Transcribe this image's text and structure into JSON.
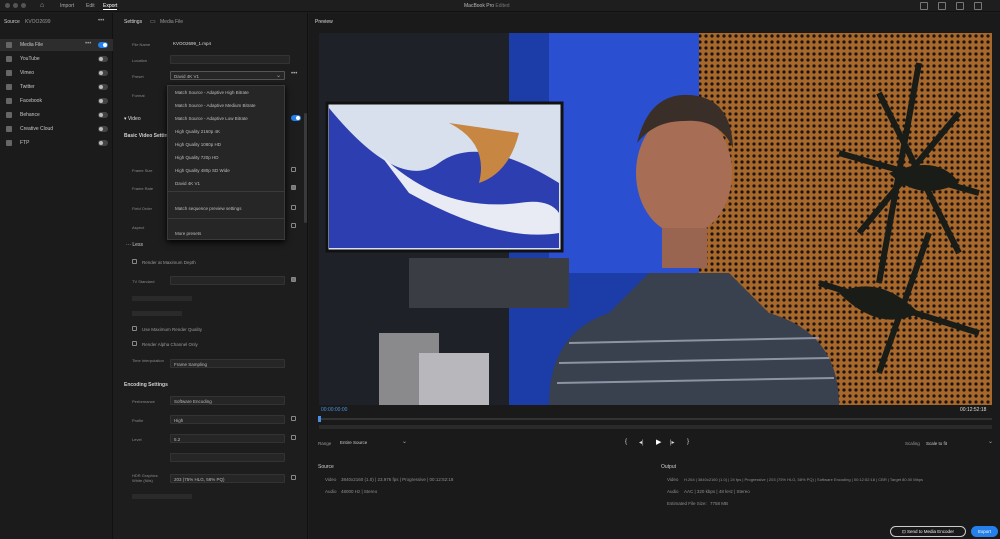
{
  "topbar": {
    "tabs": [
      "Import",
      "Edit",
      "Export"
    ],
    "window_title": "MacBook Pro",
    "document_name": "Edited"
  },
  "source": {
    "label": "Source",
    "file": "KVOO2699"
  },
  "destinations": [
    {
      "label": "Media File",
      "on": true
    },
    {
      "label": "YouTube",
      "on": false
    },
    {
      "label": "Vimeo",
      "on": false
    },
    {
      "label": "Twitter",
      "on": false
    },
    {
      "label": "Facebook",
      "on": false
    },
    {
      "label": "Behance",
      "on": false
    },
    {
      "label": "Creative Cloud",
      "on": false
    },
    {
      "label": "FTP",
      "on": false
    }
  ],
  "settings": {
    "title": "Settings",
    "subtitle": "Media File",
    "file_name_label": "File Name",
    "file_name": "KVOO2699_1.mp4",
    "location_label": "Location",
    "location": "",
    "preset_label": "Preset",
    "preset": "David 4K V1",
    "format_label": "Format",
    "video_label": "Video",
    "basic_label": "Basic Video Settings",
    "frame_size_label": "Frame Size",
    "frame_rate_label": "Frame Rate",
    "field_order_label": "Field Order",
    "aspect_label": "Aspect",
    "more_presets": "More presets",
    "less": "Less",
    "render_max_depth": "Render at Maximum Depth",
    "tv_standard_label": "TV Standard",
    "use_max_quality": "Use Maximum Render Quality",
    "render_alpha": "Render Alpha Channel Only",
    "time_interp_label": "Time Interpolation",
    "time_interp": "Frame Sampling",
    "encoding_label": "Encoding Settings",
    "performance_label": "Performance",
    "performance": "Software Encoding",
    "profile_label": "Profile",
    "profile": "High",
    "level_label": "Level",
    "level": "5.2",
    "hdr_label": "HDR Graphics White (Nits)",
    "hdr": "203 (75% HLG, 58% PQ)"
  },
  "dropdown": {
    "items": [
      "Match Source - Adaptive High Bitrate",
      "Match Source - Adaptive Medium Bitrate",
      "Match Source - Adaptive Low Bitrate",
      "High Quality 2160p 4K",
      "High Quality 1080p HD",
      "High Quality 720p HD",
      "High Quality 480p SD Wide",
      "David 4K V1",
      "Match sequence preview settings"
    ]
  },
  "preview": {
    "title": "Preview",
    "timecode_in": "00:00:00:00",
    "timecode_out": "00:12:52:18",
    "range_label": "Range",
    "range": "Entire Source",
    "scaling_label": "Scaling",
    "scaling": "Scale to fit"
  },
  "source_info": {
    "title": "Source",
    "video_label": "Video",
    "video": "3840x2160 (1.0)  |  23.976 fps  |  Progressive  |  00:12:52:18",
    "audio_label": "Audio",
    "audio": "48000 Hz  |  Stereo"
  },
  "output_info": {
    "title": "Output",
    "video_label": "Video",
    "video": "H.264  |  3840x2160 (1.0)  |  24 fps  |  Progressive  |  203 (75% HLG, 58% PQ)  |  Software Encoding  |  00:12:52:18  |  CBR  |  Target 80.00 Mbps",
    "audio_label": "Audio",
    "audio": "AAC  |  320 kbps  |  48 kHz  |  Stereo",
    "size_label": "Estimated File Size:",
    "size": "7758 MB"
  },
  "buttons": {
    "send": "Send to Media Encoder",
    "export": "Export"
  },
  "colors": {
    "accent": "#2680eb"
  }
}
